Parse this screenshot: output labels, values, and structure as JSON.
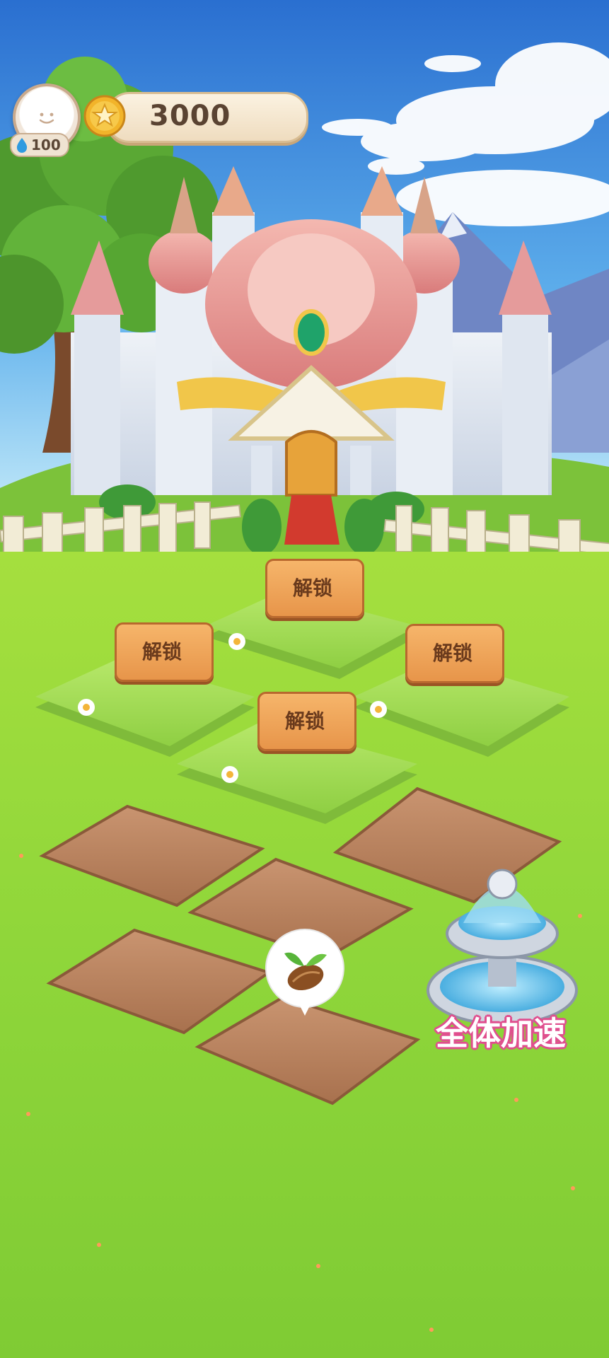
{
  "hud": {
    "water_amount": "100",
    "coins": "3000"
  },
  "plots": {
    "unlock_signs": [
      {
        "label": "解锁"
      },
      {
        "label": "解锁"
      },
      {
        "label": "解锁"
      },
      {
        "label": "解锁"
      }
    ]
  },
  "fountain": {
    "label": "全体加速"
  },
  "icons": {
    "avatar": "smiley-face-icon",
    "water": "water-drop-icon",
    "coin": "star-coin-icon",
    "seed": "seed-sprout-icon",
    "fountain": "fountain-icon"
  },
  "colors": {
    "sky": "#3d8fdc",
    "grass": "#8fd63a",
    "sign_wood": "#ee9f55",
    "accent_pink": "#e04e8e"
  }
}
